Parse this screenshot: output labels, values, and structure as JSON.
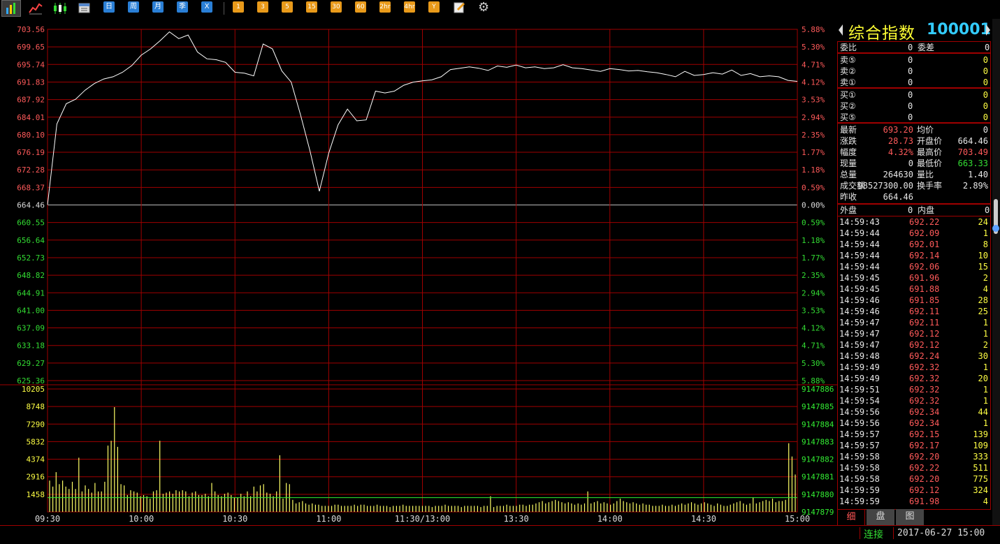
{
  "toolbar": {
    "period_buttons": [
      "日",
      "周",
      "月",
      "季",
      "X"
    ],
    "minute_buttons": [
      "1",
      "3",
      "5",
      "15",
      "30",
      "60",
      "2hr",
      "4hr",
      "Y"
    ]
  },
  "chart_data": [
    {
      "type": "line",
      "title": "",
      "prev_close": 664.46,
      "ylim": [
        625.36,
        703.56
      ],
      "left_ticks": [
        "703.56",
        "699.65",
        "695.74",
        "691.83",
        "687.92",
        "684.01",
        "680.10",
        "676.19",
        "672.28",
        "668.37",
        "664.46",
        "660.55",
        "656.64",
        "652.73",
        "648.82",
        "644.91",
        "641.00",
        "637.09",
        "633.18",
        "629.27",
        "625.36"
      ],
      "right_ticks": [
        "5.88%",
        "5.30%",
        "4.71%",
        "4.12%",
        "3.53%",
        "2.94%",
        "2.35%",
        "1.77%",
        "1.18%",
        "0.59%",
        "0.00%",
        "0.59%",
        "1.18%",
        "1.77%",
        "2.35%",
        "2.94%",
        "3.53%",
        "4.12%",
        "4.71%",
        "5.30%",
        "5.88%"
      ],
      "x_tick_labels": [
        "09:30",
        "10:00",
        "10:30",
        "11:00",
        "11:30/13:00",
        "13:30",
        "14:00",
        "14:30",
        "15:00"
      ],
      "series": [
        {
          "x": [
            0,
            3,
            6,
            9,
            12,
            15,
            18,
            21,
            24,
            27,
            30,
            33,
            36,
            39,
            42,
            45,
            48,
            51,
            54,
            57,
            60,
            63,
            66,
            69,
            72,
            75,
            78,
            81,
            84,
            87,
            90,
            93,
            96,
            99,
            102,
            105,
            108,
            111,
            114,
            117,
            120,
            123,
            126,
            129,
            132,
            135,
            138,
            141,
            144,
            147,
            150,
            153,
            156,
            159,
            162,
            165,
            168,
            171,
            174,
            177,
            180,
            183,
            186,
            189,
            192,
            195,
            198,
            201,
            204,
            207,
            210,
            213,
            216,
            219,
            222,
            225,
            228,
            231,
            234,
            237,
            240
          ],
          "y": [
            664.5,
            682.5,
            687.0,
            688.0,
            690.0,
            691.5,
            692.5,
            693.0,
            694.0,
            695.5,
            697.8,
            699.2,
            701.0,
            703.0,
            701.5,
            702.3,
            698.5,
            697.0,
            696.8,
            696.2,
            694.0,
            693.8,
            693.2,
            700.3,
            699.2,
            694.3,
            691.8,
            684.5,
            676.5,
            667.5,
            676.0,
            682.3,
            685.8,
            683.2,
            683.4,
            689.8,
            689.4,
            689.8,
            691.1,
            691.8,
            692.1,
            692.3,
            693.0,
            694.6,
            694.9,
            695.2,
            694.9,
            694.4,
            695.4,
            695.1,
            695.6,
            695.0,
            695.2,
            694.8,
            695.0,
            695.7,
            695.0,
            694.8,
            694.5,
            694.2,
            694.8,
            694.6,
            694.3,
            694.4,
            694.1,
            693.9,
            693.5,
            693.0,
            694.2,
            693.3,
            693.5,
            693.9,
            693.6,
            694.5,
            693.3,
            693.7,
            693.0,
            693.2,
            693.0,
            692.2,
            691.98
          ]
        }
      ]
    },
    {
      "type": "bar",
      "title": "",
      "ylim": [
        0,
        10205
      ],
      "left_ticks": [
        "10205",
        "8748",
        "7290",
        "5832",
        "4374",
        "2916",
        "1458"
      ],
      "right_ticks": [
        "9147886",
        "9147885",
        "9147884",
        "9147883",
        "9147882",
        "9147881",
        "9147880",
        "9147879"
      ],
      "values": [
        2600,
        2100,
        3300,
        2300,
        2600,
        2100,
        1900,
        2500,
        1900,
        4500,
        1700,
        2200,
        1900,
        1600,
        2400,
        1700,
        1700,
        2500,
        5500,
        5900,
        8700,
        5400,
        2300,
        2200,
        1400,
        1800,
        1700,
        1600,
        1300,
        1400,
        1300,
        1100,
        1700,
        1800,
        5900,
        1500,
        1600,
        1700,
        1500,
        1800,
        1700,
        1800,
        1700,
        1300,
        1600,
        1700,
        1400,
        1400,
        1500,
        1300,
        2400,
        1700,
        1400,
        1300,
        1500,
        1600,
        1400,
        1200,
        1200,
        1500,
        1300,
        1700,
        1300,
        2100,
        1700,
        2200,
        2300,
        1600,
        1500,
        1300,
        1700,
        4700,
        1100,
        2400,
        2300,
        1000,
        700,
        800,
        900,
        700,
        600,
        700,
        600,
        600,
        500,
        500,
        500,
        500,
        600,
        600,
        500,
        500,
        500,
        500,
        600,
        500,
        600,
        600,
        500,
        500,
        500,
        600,
        500,
        500,
        500,
        400,
        500,
        500,
        500,
        600,
        500,
        500,
        500,
        500,
        500,
        500,
        500,
        500,
        400,
        500,
        500,
        500,
        600,
        500,
        500,
        500,
        500,
        400,
        500,
        500,
        500,
        500,
        500,
        400,
        500,
        500,
        1300,
        400,
        500,
        500,
        500,
        600,
        500,
        500,
        500,
        600,
        600,
        500,
        600,
        600,
        700,
        800,
        900,
        700,
        800,
        900,
        1000,
        900,
        800,
        700,
        800,
        700,
        600,
        700,
        600,
        700,
        1700,
        700,
        800,
        900,
        700,
        800,
        700,
        600,
        700,
        900,
        1100,
        900,
        800,
        700,
        800,
        700,
        600,
        700,
        600,
        600,
        500,
        500,
        500,
        600,
        500,
        500,
        600,
        500,
        600,
        700,
        600,
        700,
        800,
        700,
        600,
        700,
        800,
        700,
        600,
        500,
        700,
        600,
        500,
        500,
        600,
        700,
        800,
        900,
        700,
        600,
        700,
        1200,
        700,
        800,
        900,
        1000,
        900,
        1100,
        800,
        900,
        900,
        1000,
        5700,
        4600,
        3100
      ]
    }
  ],
  "panel": {
    "title": "综合指数",
    "code": "100001",
    "weibi_label": "委比",
    "weibi_value": "0",
    "weicha_label": "委差",
    "weicha_value": "0",
    "sell": [
      {
        "label": "卖⑤",
        "price": "0",
        "vol": "0"
      },
      {
        "label": "卖②",
        "price": "0",
        "vol": "0"
      },
      {
        "label": "卖①",
        "price": "0",
        "vol": "0"
      }
    ],
    "buy": [
      {
        "label": "买①",
        "price": "0",
        "vol": "0"
      },
      {
        "label": "买②",
        "price": "0",
        "vol": "0"
      },
      {
        "label": "买⑤",
        "price": "0",
        "vol": "0"
      }
    ],
    "quote": [
      {
        "l1": "最新",
        "v1": "693.20",
        "c1": "red",
        "l2": "均价",
        "v2": "0",
        "c2": "white"
      },
      {
        "l1": "涨跌",
        "v1": "28.73",
        "c1": "red",
        "l2": "开盘价",
        "v2": "664.46",
        "c2": "white"
      },
      {
        "l1": "幅度",
        "v1": "4.32%",
        "c1": "red",
        "l2": "最高价",
        "v2": "703.49",
        "c2": "red"
      },
      {
        "l1": "现量",
        "v1": "0",
        "c1": "white",
        "l2": "最低价",
        "v2": "663.33",
        "c2": "green"
      },
      {
        "l1": "总量",
        "v1": "264630",
        "c1": "white",
        "l2": "量比",
        "v2": "1.40",
        "c2": "white"
      },
      {
        "l1": "成交额",
        "v1": "98527300.00",
        "c1": "white",
        "l2": "换手率",
        "v2": "2.89%",
        "c2": "white"
      },
      {
        "l1": "昨收",
        "v1": "664.46",
        "c1": "white",
        "l2": "",
        "v2": "",
        "c2": "white"
      }
    ],
    "waipan_label": "外盘",
    "waipan_value": "0",
    "neipan_label": "内盘",
    "neipan_value": "0",
    "ticks": [
      {
        "time": "14:59:43",
        "price": "692.22",
        "vol": "24"
      },
      {
        "time": "14:59:44",
        "price": "692.09",
        "vol": "1"
      },
      {
        "time": "14:59:44",
        "price": "692.01",
        "vol": "8"
      },
      {
        "time": "14:59:44",
        "price": "692.14",
        "vol": "10"
      },
      {
        "time": "14:59:44",
        "price": "692.06",
        "vol": "15"
      },
      {
        "time": "14:59:45",
        "price": "691.96",
        "vol": "2"
      },
      {
        "time": "14:59:45",
        "price": "691.88",
        "vol": "4"
      },
      {
        "time": "14:59:46",
        "price": "691.85",
        "vol": "28"
      },
      {
        "time": "14:59:46",
        "price": "692.11",
        "vol": "25"
      },
      {
        "time": "14:59:47",
        "price": "692.11",
        "vol": "1"
      },
      {
        "time": "14:59:47",
        "price": "692.12",
        "vol": "1"
      },
      {
        "time": "14:59:47",
        "price": "692.12",
        "vol": "2"
      },
      {
        "time": "14:59:48",
        "price": "692.24",
        "vol": "30"
      },
      {
        "time": "14:59:49",
        "price": "692.32",
        "vol": "1"
      },
      {
        "time": "14:59:49",
        "price": "692.32",
        "vol": "20"
      },
      {
        "time": "14:59:51",
        "price": "692.32",
        "vol": "1"
      },
      {
        "time": "14:59:54",
        "price": "692.32",
        "vol": "1"
      },
      {
        "time": "14:59:56",
        "price": "692.34",
        "vol": "44"
      },
      {
        "time": "14:59:56",
        "price": "692.34",
        "vol": "1"
      },
      {
        "time": "14:59:57",
        "price": "692.15",
        "vol": "139"
      },
      {
        "time": "14:59:57",
        "price": "692.17",
        "vol": "109"
      },
      {
        "time": "14:59:58",
        "price": "692.20",
        "vol": "333"
      },
      {
        "time": "14:59:58",
        "price": "692.22",
        "vol": "511"
      },
      {
        "time": "14:59:58",
        "price": "692.20",
        "vol": "775"
      },
      {
        "time": "14:59:59",
        "price": "692.12",
        "vol": "324"
      },
      {
        "time": "14:59:59",
        "price": "691.98",
        "vol": "4"
      }
    ],
    "tabs": [
      "细",
      "盘",
      "图"
    ]
  },
  "status": {
    "connection": "连接",
    "datetime": "2017-06-27 15:00"
  },
  "colors": {
    "grid": "#a00000",
    "price_line": "#ffffff",
    "volume_bar": "#ffff66",
    "avg_volume_line": "#33ee33",
    "up": "#ff5a5a",
    "down": "#33dd33"
  }
}
